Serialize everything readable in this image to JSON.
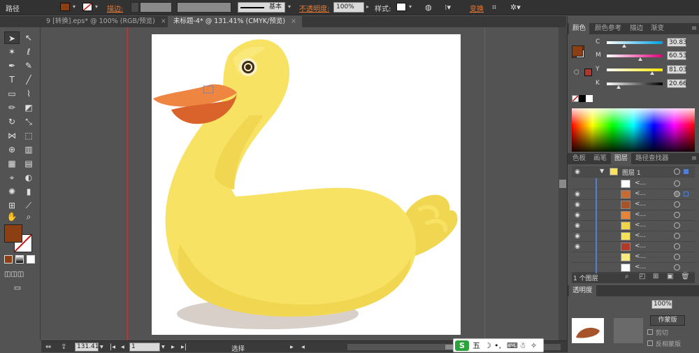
{
  "control_bar": {
    "object_type": "路径",
    "stroke_label": "描边:",
    "stroke_style": "基本",
    "opacity_label": "不透明度:",
    "opacity_value": "100%",
    "style_label": "样式:",
    "transform_label": "变换",
    "fill_color": "#8b3f12"
  },
  "doc_tabs": [
    {
      "label": "9 [转换].eps* @ 100% (RGB/预览)",
      "close": "×",
      "active": false
    },
    {
      "label": "未标题-4* @ 131.41% (CMYK/预览)",
      "close": "×",
      "active": true
    }
  ],
  "tools": {
    "fill_color": "#8b3f12",
    "stroke_color": "none",
    "items": [
      "selection-tool",
      "direct-selection-tool",
      "magic-wand-tool",
      "lasso-tool",
      "pen-tool",
      "curvature-tool",
      "type-tool",
      "line-tool",
      "rectangle-tool",
      "paintbrush-tool",
      "pencil-tool",
      "eraser-tool",
      "rotate-tool",
      "scale-tool",
      "width-tool",
      "free-transform-tool",
      "shape-builder-tool",
      "perspective-grid-tool",
      "mesh-tool",
      "gradient-tool",
      "eyedropper-tool",
      "blend-tool",
      "symbol-sprayer-tool",
      "column-graph-tool",
      "artboard-tool",
      "slice-tool",
      "hand-tool",
      "zoom-tool"
    ]
  },
  "status_bar": {
    "zoom": "131.41",
    "artboard_number": "1",
    "tool_name": "选择"
  },
  "ime_bar": {
    "logo": "S",
    "mode": "五"
  },
  "color_panel": {
    "tabs": [
      "颜色",
      "颜色参考",
      "描边",
      "渐变"
    ],
    "active_tab": "颜色",
    "channels": [
      {
        "label": "C",
        "value": "30.83",
        "fraction": 0.3083,
        "gradient": [
          "#ffffff",
          "#00a0e0"
        ]
      },
      {
        "label": "M",
        "value": "60.53",
        "fraction": 0.6053,
        "gradient": [
          "#ffffff",
          "#e0007a"
        ]
      },
      {
        "label": "Y",
        "value": "81.03",
        "fraction": 0.8103,
        "gradient": [
          "#ffffff",
          "#ffe600"
        ]
      },
      {
        "label": "K",
        "value": "20.66",
        "fraction": 0.2066,
        "gradient": [
          "#ffffff",
          "#000000"
        ]
      }
    ],
    "current_color": "#8b3f12"
  },
  "layers_panel": {
    "tabs": [
      "色板",
      "画笔",
      "图层",
      "路径查找器"
    ],
    "active_tab": "图层",
    "parent_layer": "图层 1",
    "sublayers": [
      {
        "name": "<...",
        "thumb": "#ffffff",
        "visible": false,
        "selected": false
      },
      {
        "name": "<...",
        "thumb": "#c86a34",
        "visible": true,
        "selected": true
      },
      {
        "name": "<...",
        "thumb": "#a8542a",
        "visible": true,
        "selected": false
      },
      {
        "name": "<...",
        "thumb": "#e8843a",
        "visible": true,
        "selected": false
      },
      {
        "name": "<...",
        "thumb": "#f0d44a",
        "visible": true,
        "selected": false
      },
      {
        "name": "<...",
        "thumb": "#f6e15a",
        "visible": true,
        "selected": false
      },
      {
        "name": "<...",
        "thumb": "#b23a2a",
        "visible": true,
        "selected": false
      },
      {
        "name": "<...",
        "thumb": "#f8e880",
        "visible": false,
        "selected": false
      },
      {
        "name": "<...",
        "thumb": "#ffffff",
        "visible": false,
        "selected": false
      }
    ],
    "footer_count": "1 个图层"
  },
  "transparency_panel": {
    "tab": "透明度",
    "opacity": "100%",
    "make_mask": "作蒙版",
    "clip": "剪切",
    "invert_mask": "反相蒙版"
  },
  "artwork": {
    "body_color": "#f7e264",
    "shade_color": "#f1d651",
    "beak_color": "#ee8540",
    "beak_shade": "#d9632a",
    "shadow_color": "#d8cfc8",
    "eye_ring": "#f8f0c0",
    "eye_color": "#3a2a1a"
  }
}
